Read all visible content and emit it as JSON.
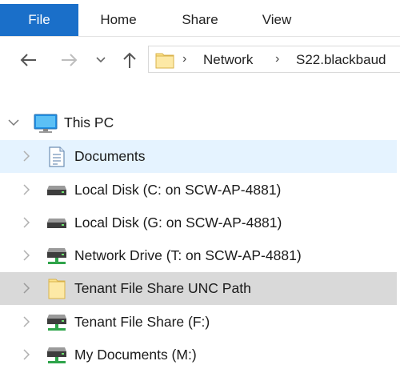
{
  "ribbon": {
    "tabs": [
      {
        "label": "File",
        "active": true
      },
      {
        "label": "Home",
        "active": false
      },
      {
        "label": "Share",
        "active": false
      },
      {
        "label": "View",
        "active": false
      }
    ],
    "accent": "#1a6fc9"
  },
  "address": {
    "crumbs": [
      "Network",
      "S22.blackbaud"
    ]
  },
  "tree": {
    "root": {
      "label": "This PC",
      "icon": "computer-icon"
    },
    "items": [
      {
        "label": "Documents",
        "icon": "documents-icon"
      },
      {
        "label": "Local Disk (C: on SCW-AP-4881)",
        "icon": "drive-icon"
      },
      {
        "label": "Local Disk (G: on SCW-AP-4881)",
        "icon": "drive-icon"
      },
      {
        "label": "Network Drive (T: on SCW-AP-4881)",
        "icon": "network-drive-icon"
      },
      {
        "label": "Tenant File Share UNC Path",
        "icon": "folder-icon"
      },
      {
        "label": "Tenant File Share (F:)",
        "icon": "network-drive-icon"
      },
      {
        "label": "My Documents (M:)",
        "icon": "network-drive-icon"
      }
    ],
    "hover_color": "#e5f3ff",
    "selected_color": "#d9d9d9"
  }
}
